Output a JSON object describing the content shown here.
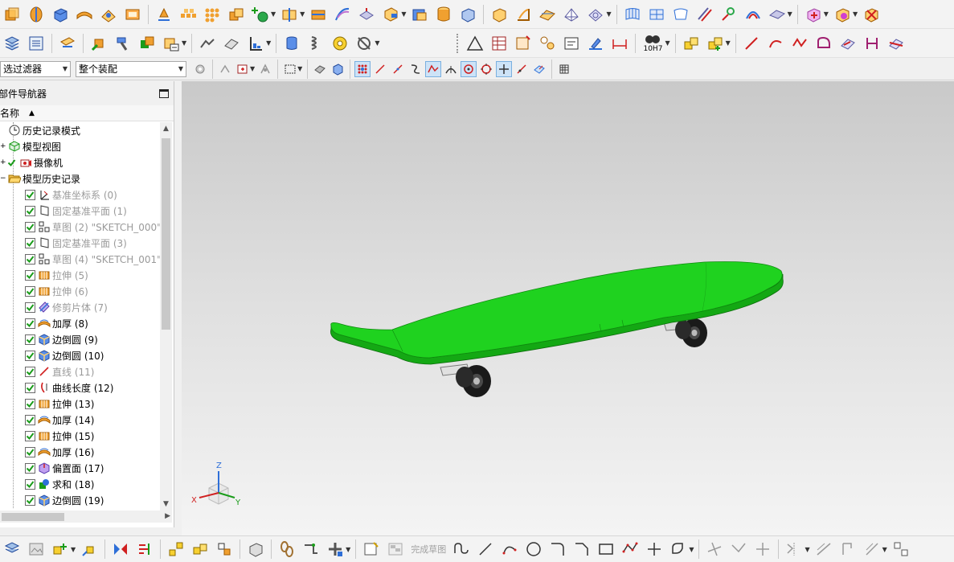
{
  "filters": {
    "selection_filter": "选过滤器",
    "assembly_scope": "整个装配"
  },
  "toolbar_bottom": {
    "finish_sketch_label": "完成草图"
  },
  "navigator": {
    "title": "部件导航器",
    "column_header": "名称",
    "top_nodes": [
      {
        "label": "历史记录模式",
        "icon": "clock-icon"
      },
      {
        "label": "模型视图",
        "icon": "model-views-icon"
      },
      {
        "label": "摄像机",
        "icon": "camera-icon"
      },
      {
        "label": "模型历史记录",
        "icon": "folder-open-icon"
      }
    ],
    "features": [
      {
        "label": "基准坐标系 (0)",
        "icon": "datum-csys-icon",
        "dim": true
      },
      {
        "label": "固定基准平面 (1)",
        "icon": "datum-plane-icon",
        "dim": true
      },
      {
        "label": "草图 (2) \"SKETCH_000\"",
        "icon": "sketch-icon",
        "dim": true
      },
      {
        "label": "固定基准平面 (3)",
        "icon": "datum-plane-icon",
        "dim": true
      },
      {
        "label": "草图 (4) \"SKETCH_001\"",
        "icon": "sketch-icon",
        "dim": true
      },
      {
        "label": "拉伸 (5)",
        "icon": "extrude-icon",
        "dim": true
      },
      {
        "label": "拉伸 (6)",
        "icon": "extrude-icon",
        "dim": true
      },
      {
        "label": "修剪片体 (7)",
        "icon": "trim-sheet-icon",
        "dim": true
      },
      {
        "label": "加厚 (8)",
        "icon": "thicken-icon",
        "dim": false
      },
      {
        "label": "边倒圆 (9)",
        "icon": "edge-blend-icon",
        "dim": false
      },
      {
        "label": "边倒圆 (10)",
        "icon": "edge-blend-icon",
        "dim": false
      },
      {
        "label": "直线 (11)",
        "icon": "line-icon",
        "dim": true
      },
      {
        "label": "曲线长度 (12)",
        "icon": "curve-length-icon",
        "dim": false
      },
      {
        "label": "拉伸 (13)",
        "icon": "extrude-icon",
        "dim": false
      },
      {
        "label": "加厚 (14)",
        "icon": "thicken-icon",
        "dim": false
      },
      {
        "label": "拉伸 (15)",
        "icon": "extrude-icon",
        "dim": false
      },
      {
        "label": "加厚 (16)",
        "icon": "thicken-icon",
        "dim": false
      },
      {
        "label": "偏置面 (17)",
        "icon": "offset-face-icon",
        "dim": false
      },
      {
        "label": "求和 (18)",
        "icon": "unite-icon",
        "dim": false
      },
      {
        "label": "边倒圆 (19)",
        "icon": "edge-blend-icon",
        "dim": false
      }
    ]
  },
  "tolerance_label": "10H7",
  "triad": {
    "x": "X",
    "y": "Y",
    "z": "Z"
  },
  "colors": {
    "deck_green": "#1fd21f",
    "deck_dark": "#14a814",
    "accent_blue": "#2e6fd8",
    "check_green": "#1a9c1a"
  }
}
